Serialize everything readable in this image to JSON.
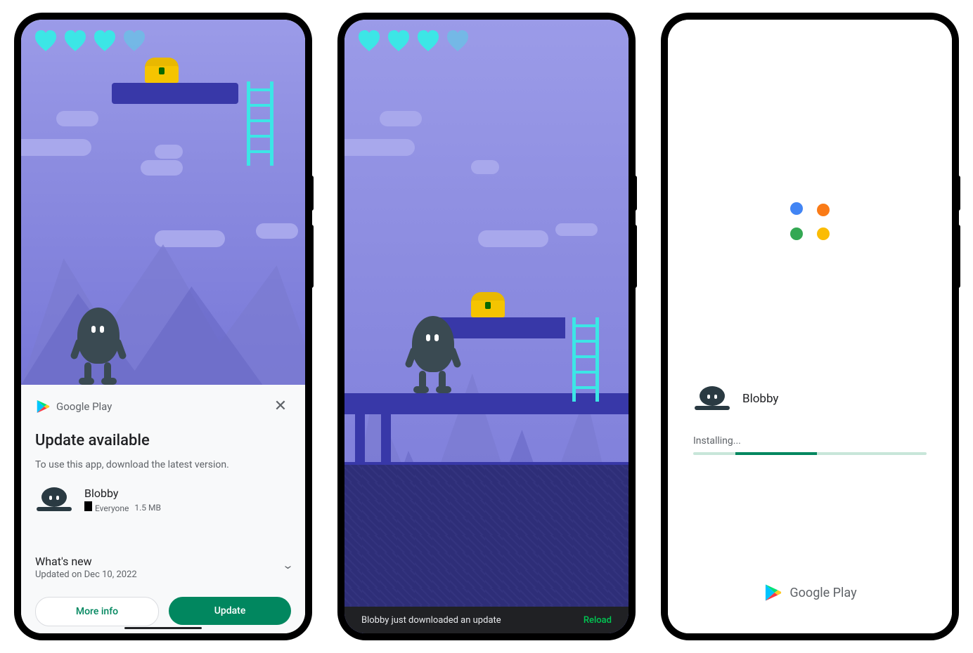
{
  "brand": "Google Play",
  "screen1": {
    "title": "Update available",
    "subtitle": "To use this app, download the latest version.",
    "app_name": "Blobby",
    "rating_label": "Everyone",
    "size": "1.5 MB",
    "whats_new_title": "What's new",
    "whats_new_date": "Updated on Dec 10, 2022",
    "more_info": "More info",
    "update": "Update"
  },
  "screen2": {
    "snackbar_msg": "Blobby just downloaded an update",
    "snackbar_action": "Reload"
  },
  "screen3": {
    "app_name": "Blobby",
    "status": "Installing..."
  }
}
